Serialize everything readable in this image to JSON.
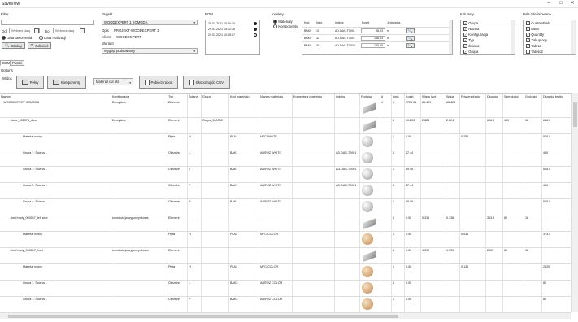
{
  "title": "SaveView",
  "filter": {
    "label": "Filter",
    "od": "Od",
    "do": "Do",
    "date_placeholder": "Wybierz datę",
    "date_created": "Data utworzenia",
    "date_realized": "Data realizacji",
    "search_btn": "Szukaj",
    "refresh_btn": "Odśwież"
  },
  "project": {
    "label": "Projekt",
    "selected": "WOODEXPERT 1 KOMODA",
    "opis_label": "Opis",
    "opis": "PROJEKT-WOODEXPERT 1",
    "klient_label": "Klient",
    "klient": "WOODEXPERT",
    "wariant_label": "Wariant",
    "wariant": "Wygląd podstawowy"
  },
  "bom": {
    "label": "BOM",
    "entries": [
      "29.01.2021 15:20:10",
      "29.01.2021 15:12:36",
      "29.01.2021 10:55:07"
    ]
  },
  "indexes": {
    "label": "Indeksy",
    "radio_materials": "Materiały",
    "radio_components": "Komponenty",
    "columns": [
      "Kod",
      "Ilość",
      "Indeks",
      "Koszt",
      "Jednostka"
    ],
    "rows": [
      [
        "BAK0",
        "10",
        "AD.DAS-T0001",
        "98,03",
        "m"
      ],
      [
        "BAK0",
        "32",
        "AD.DAS-T0001",
        "138,03",
        "m"
      ],
      [
        "BAK0",
        "38",
        "AD.DAS-T0002",
        "150,00",
        "m"
      ]
    ]
  },
  "columns_panel": {
    "label": "Kolumny",
    "items": [
      "Grupa",
      "Nazwa",
      "Konfiguracja",
      "Typ",
      "Ściana",
      "Grupa"
    ]
  },
  "userfields": {
    "label": "Pola zdefiniowane",
    "items": [
      "CustomField",
      "Autor",
      "Quantity",
      "Zakupiony",
      "TabNo",
      "TabNo2"
    ]
  },
  "tabs": [
    "BOM",
    "Paczki"
  ],
  "options_label": "Options",
  "view_label": "Widok",
  "toolbar": {
    "full": "Pełny",
    "components": "Komponenty",
    "material_list": "Material cut list",
    "get_report": "Pobierz raport",
    "export_csv": "Eksportuj do CSV"
  },
  "grid": {
    "headers": [
      "Nazwa",
      "Konfiguracja",
      "Typ",
      "Ściana",
      "Grupa",
      "Kod materiału",
      "Nazwa materiału",
      "Komentarz materiału",
      "Indeks",
      "Podgląd",
      "#",
      "Ilość",
      "Koszt",
      "Waga (szt.)",
      "Waga",
      "Powierzchnia",
      "Długość",
      "Szerokość",
      "Grubość",
      "Długość brutto"
    ],
    "rows": [
      {
        "name": "- WOODEXPERT KOMODA",
        "conf": "Domyślna",
        "typ": "Złożenie",
        "sciana": "",
        "grupa": "",
        "kod": "",
        "nazwa_m": "",
        "kom": "",
        "idx": "",
        "p": "",
        "n": "1",
        "ilosc": "1",
        "koszt": "2726.51",
        "wsz": "86.429",
        "w": "86.429",
        "pow": "",
        "dl": "",
        "sz": "",
        "gr": "",
        "dlb": ""
      },
      {
        "name": "- door_005371_door",
        "conf": "Domyślna",
        "typ": "Element",
        "sciana": "",
        "grupa": "Grupa_000006",
        "kod": "",
        "nazwa_m": "",
        "kom": "",
        "idx": "",
        "p": "PLA1",
        "n": "",
        "ilosc": "1",
        "koszt": "194.00",
        "wsz": "2.824",
        "w": "2.824",
        "pow": "",
        "dl": "606.5",
        "sz": "400",
        "gr": "18",
        "dlb": "616.5"
      },
      {
        "name": "Materiał nośny",
        "conf": "",
        "typ": "Płyta",
        "sciana": "H",
        "grupa": "",
        "kod": "PLA1",
        "nazwa_m": "MFC WHITE",
        "kom": "",
        "idx": "",
        "p": "",
        "n": "",
        "ilosc": "1",
        "koszt": "0.00",
        "wsz": "",
        "w": "",
        "pow": "0.253",
        "dl": "",
        "sz": "",
        "gr": "",
        "dlb": "515.5"
      },
      {
        "name": "Grupa 1: Ściana 1",
        "conf": "",
        "typ": "Obrzeże",
        "sciana": "L",
        "grupa": "",
        "kod": "BAK1",
        "nazwa_m": "ABSWZ WHITE",
        "kom": "",
        "idx": "AD.DAS-T0001",
        "p": "",
        "n": "",
        "ilosc": "1",
        "koszt": "47.44",
        "wsz": "",
        "w": "",
        "pow": "",
        "dl": "",
        "sz": "",
        "gr": "",
        "dlb": "480"
      },
      {
        "name": "Grupa 1: Ściana 1",
        "conf": "",
        "typ": "Obrzeże",
        "sciana": "T",
        "grupa": "",
        "kod": "BAK1",
        "nazwa_m": "ABSWZ WHITE",
        "kom": "",
        "idx": "AD.DAS-T0001",
        "p": "",
        "n": "",
        "ilosc": "1",
        "koszt": "49.96",
        "wsz": "",
        "w": "",
        "pow": "",
        "dl": "",
        "sz": "",
        "gr": "",
        "dlb": "505.5"
      },
      {
        "name": "Grupa 3: Ściana 1",
        "conf": "",
        "typ": "Obrzeże",
        "sciana": "P",
        "grupa": "",
        "kod": "BAK1",
        "nazwa_m": "ABSWZ WHITE",
        "kom": "",
        "idx": "AD.DAS-T0001",
        "p": "",
        "n": "",
        "ilosc": "1",
        "koszt": "47.44",
        "wsz": "",
        "w": "",
        "pow": "",
        "dl": "",
        "sz": "",
        "gr": "",
        "dlb": "480"
      },
      {
        "name": "Grupa 4: Ściana 1",
        "conf": "",
        "typ": "Obrzeże",
        "sciana": "P",
        "grupa": "",
        "kod": "BAK1",
        "nazwa_m": "ABSWZ WHITE",
        "kom": "",
        "idx": "",
        "p": "",
        "n": "",
        "ilosc": "1",
        "koszt": "49.96",
        "wsz": "",
        "w": "",
        "pow": "",
        "dl": "",
        "sz": "",
        "gr": "",
        "dlb": "505.5"
      },
      {
        "name": "- bed body_003557_left side",
        "conf": "konstrukcja wypoczynkowa",
        "typ": "Element",
        "sciana": "",
        "grupa": "",
        "kod": "",
        "nazwa_m": "",
        "kom": "",
        "idx": "",
        "p": "PLA3",
        "n": "",
        "ilosc": "1",
        "koszt": "0.00",
        "wsz": "0.336",
        "w": "0.336",
        "pow": "",
        "dl": "363.5",
        "sz": "80",
        "gr": "18",
        "dlb": ""
      },
      {
        "name": "Materiał nośny",
        "conf": "",
        "typ": "Płyta",
        "sciana": "H",
        "grupa": "",
        "kod": "PLA3",
        "nazwa_m": "MFC COLOR",
        "kom": "",
        "idx": "",
        "p": "",
        "n": "",
        "ilosc": "1",
        "koszt": "0.00",
        "wsz": "",
        "w": "",
        "pow": "0.034",
        "dl": "",
        "sz": "",
        "gr": "",
        "dlb": "373.5"
      },
      {
        "name": "- bed body_003557_front",
        "conf": "konstrukcja wypoczynkowa",
        "typ": "Element",
        "sciana": "",
        "grupa": "",
        "kod": "",
        "nazwa_m": "",
        "kom": "",
        "idx": "",
        "p": "PLA3",
        "n": "",
        "ilosc": "1",
        "koszt": "0.00",
        "wsz": "1.399",
        "w": "1.399",
        "pow": "",
        "dl": "2500",
        "sz": "80",
        "gr": "18",
        "dlb": ""
      },
      {
        "name": "Materiał nośny",
        "conf": "",
        "typ": "Płyta",
        "sciana": "H",
        "grupa": "",
        "kod": "PLA3",
        "nazwa_m": "MFC COLOR",
        "kom": "",
        "idx": "",
        "p": "",
        "n": "",
        "ilosc": "1",
        "koszt": "0.00",
        "wsz": "",
        "w": "",
        "pow": "0.136",
        "dl": "",
        "sz": "",
        "gr": "",
        "dlb": "2520"
      },
      {
        "name": "Grupa 1: Ściana 1",
        "conf": "",
        "typ": "Obrzeże",
        "sciana": "L",
        "grupa": "",
        "kod": "BAK3",
        "nazwa_m": "ABSWZ COLOR",
        "kom": "",
        "idx": "",
        "p": "",
        "n": "",
        "ilosc": "1",
        "koszt": "0.00",
        "wsz": "",
        "w": "",
        "pow": "",
        "dl": "",
        "sz": "",
        "gr": "",
        "dlb": "80"
      },
      {
        "name": "Grupa 1: Ściana 1",
        "conf": "",
        "typ": "Obrzeże",
        "sciana": "P",
        "grupa": "",
        "kod": "BAK3",
        "nazwa_m": "ABSWZ COLOR",
        "kom": "",
        "idx": "",
        "p": "",
        "n": "",
        "ilosc": "1",
        "koszt": "0.00",
        "wsz": "",
        "w": "",
        "pow": "",
        "dl": "",
        "sz": "",
        "gr": "",
        "dlb": "80"
      }
    ]
  }
}
